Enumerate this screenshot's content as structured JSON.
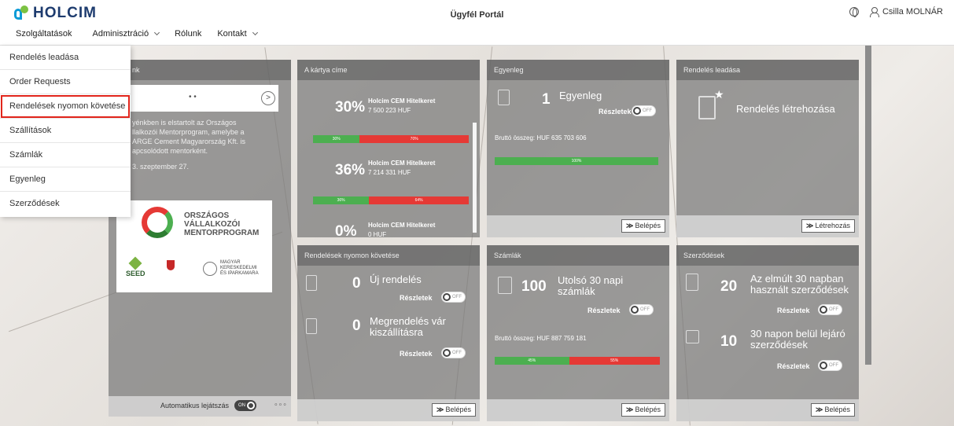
{
  "header": {
    "brand": "HOLCIM",
    "portal_title": "Ügyfél Portál",
    "user_name": "Csilla MOLNÁR"
  },
  "nav": {
    "items": [
      "Szolgáltatások",
      "Adminisztráció",
      "Rólunk",
      "Kontakt"
    ]
  },
  "dropdown": {
    "items": [
      "Rendelés leadása",
      "Order Requests",
      "Rendelések nyomon követése",
      "Szállítások",
      "Számlák",
      "Egyenleg",
      "Szerződések"
    ],
    "active_index": 2
  },
  "news": {
    "title": "nk",
    "body": [
      "yénkben is elstartolt az Országos",
      "llalkozói Mentorprogram, amelybe a",
      "ARGE Cement Magyarország Kft. is",
      "apcsolódott mentorként."
    ],
    "date": "3. szeptember 27.",
    "logo_lines": [
      "ORSZÁGOS",
      "VÁLLALKOZÓI",
      "MENTORPROGRAM"
    ],
    "seed": "SEED",
    "chamber": [
      "MAGYAR",
      "KERESKEDELMI",
      "ÉS IPARKAMARA"
    ],
    "autoplay_label": "Automatikus lejátszás",
    "toggle_on": "ON"
  },
  "card": {
    "title": "A kártya címe",
    "rows": [
      {
        "pct": "30%",
        "name": "Holcim CEM Hitelkeret",
        "amount": "7 500 223 HUF",
        "used": "30%",
        "free": "70%",
        "used_frac": 0.3
      },
      {
        "pct": "36%",
        "name": "Holcim CEM Hitelkeret",
        "amount": "7 214 331 HUF",
        "used": "36%",
        "free": "64%",
        "used_frac": 0.36
      },
      {
        "pct": "0%",
        "name": "Holcim CEM Hitelkeret",
        "amount": "0 HUF"
      }
    ]
  },
  "egyenleg": {
    "title": "Egyenleg",
    "count": "1",
    "label": "Egyenleg",
    "details": "Részletek",
    "gross": "Bruttó összeg: HUF 635 703 606",
    "bar_label": "100%",
    "bar_frac": 1.0,
    "enter": "Belépés"
  },
  "rendeles": {
    "title": "Rendelés leadása",
    "label": "Rendelés létrehozása",
    "create": "Létrehozás"
  },
  "tracking": {
    "title": "Rendelések nyomon követése",
    "items": [
      {
        "count": "0",
        "label": "Új rendelés",
        "details": "Részletek"
      },
      {
        "count": "0",
        "label": "Megrendelés vár kiszállításra",
        "details": "Részletek"
      }
    ],
    "enter": "Belépés"
  },
  "szamlak": {
    "title": "Számlák",
    "count": "100",
    "label": "Utolsó 30 napi számlák",
    "details": "Részletek",
    "gross": "Bruttó összeg: HUF 887 759 181",
    "paid": "45%",
    "unpaid": "55%",
    "paid_frac": 0.45,
    "enter": "Belépés"
  },
  "szerzodesek": {
    "title": "Szerződések",
    "items": [
      {
        "count": "20",
        "label": "Az elmúlt 30 napban használt szerződések",
        "details": "Részletek"
      },
      {
        "count": "10",
        "label": "30 napon belül lejáró szerződések",
        "details": "Részletek"
      }
    ],
    "enter": "Belépés"
  },
  "toggle_off": "OFF",
  "colors": {
    "green": "#4caf50",
    "red": "#e53935",
    "brand": "#1d3b6e",
    "highlight": "#e1251b"
  }
}
